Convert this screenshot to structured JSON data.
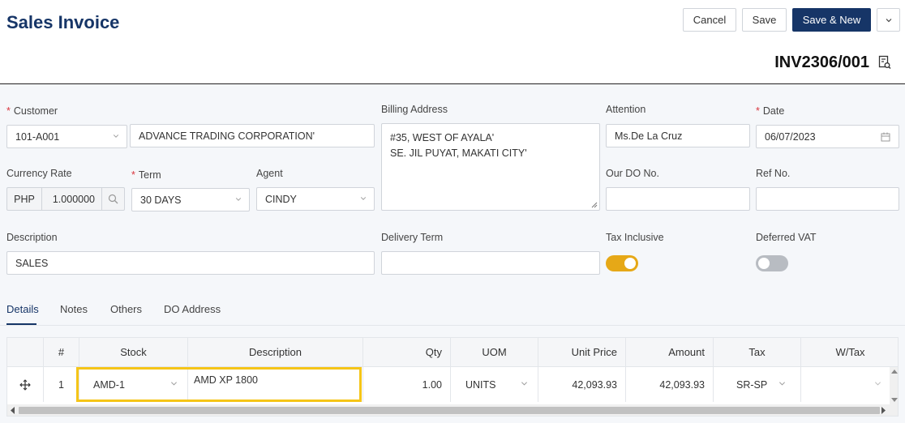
{
  "header": {
    "title": "Sales Invoice",
    "cancel_label": "Cancel",
    "save_label": "Save",
    "save_new_label": "Save & New",
    "invoice_number": "INV2306/001"
  },
  "form": {
    "customer_label": "Customer",
    "customer_code": "101-A001",
    "customer_name": "ADVANCE TRADING CORPORATION'",
    "billing_address_label": "Billing Address",
    "billing_address_line1": "#35, WEST OF AYALA'",
    "billing_address_line2": "SE. JIL PUYAT, MAKATI CITY'",
    "attention_label": "Attention",
    "attention_value": "Ms.De La Cruz",
    "date_label": "Date",
    "date_value": "06/07/2023",
    "currency_rate_label": "Currency Rate",
    "currency": "PHP",
    "rate": "1.000000",
    "term_label": "Term",
    "term_value": "30 DAYS",
    "agent_label": "Agent",
    "agent_value": "CINDY",
    "our_do_label": "Our DO No.",
    "our_do_value": "",
    "ref_no_label": "Ref No.",
    "ref_no_value": "",
    "description_label": "Description",
    "description_value": "SALES",
    "delivery_term_label": "Delivery Term",
    "delivery_term_value": "",
    "tax_inclusive_label": "Tax Inclusive",
    "tax_inclusive_on": true,
    "deferred_vat_label": "Deferred VAT",
    "deferred_vat_on": false
  },
  "tabs": [
    "Details",
    "Notes",
    "Others",
    "DO Address"
  ],
  "table": {
    "columns": [
      "#",
      "Stock",
      "Description",
      "Qty",
      "UOM",
      "Unit Price",
      "Amount",
      "Tax",
      "W/Tax"
    ],
    "rows": [
      {
        "no": "1",
        "stock": "AMD-1",
        "description": "AMD XP 1800",
        "qty": "1.00",
        "uom": "UNITS",
        "unit_price": "42,093.93",
        "amount": "42,093.93",
        "tax": "SR-SP",
        "wtax": ""
      }
    ]
  },
  "colors": {
    "primary": "#163567",
    "toggle_on": "#e6a817",
    "toggle_off": "#b8bcc2",
    "highlight": "#f5c518",
    "required": "#d9363e"
  }
}
